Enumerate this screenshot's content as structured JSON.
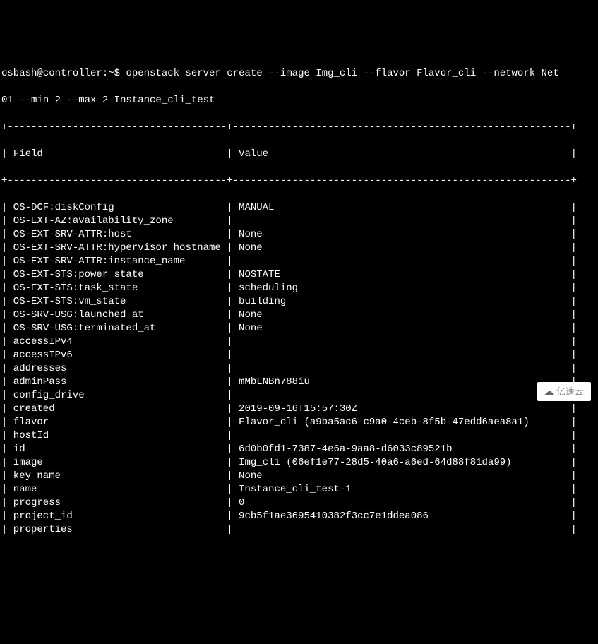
{
  "prompt": {
    "user_host": "osbash@controller:~$",
    "command": "openstack server create --image Img_cli --flavor Flavor_cli --network Net",
    "command_line2": "01 --min 2 --max 2 Instance_cli_test"
  },
  "table": {
    "border_top": "+-----------------------------------+---------------------------------------------+",
    "header_field": "Field",
    "header_value": "Value",
    "rows": [
      {
        "field": "OS-DCF:diskConfig",
        "value": "MANUAL"
      },
      {
        "field": "OS-EXT-AZ:availability_zone",
        "value": ""
      },
      {
        "field": "OS-EXT-SRV-ATTR:host",
        "value": "None"
      },
      {
        "field": "OS-EXT-SRV-ATTR:hypervisor_hostname",
        "value": "None"
      },
      {
        "field": "OS-EXT-SRV-ATTR:instance_name",
        "value": ""
      },
      {
        "field": "OS-EXT-STS:power_state",
        "value": "NOSTATE"
      },
      {
        "field": "OS-EXT-STS:task_state",
        "value": "scheduling"
      },
      {
        "field": "OS-EXT-STS:vm_state",
        "value": "building"
      },
      {
        "field": "OS-SRV-USG:launched_at",
        "value": "None"
      },
      {
        "field": "OS-SRV-USG:terminated_at",
        "value": "None"
      },
      {
        "field": "accessIPv4",
        "value": ""
      },
      {
        "field": "accessIPv6",
        "value": ""
      },
      {
        "field": "addresses",
        "value": ""
      },
      {
        "field": "adminPass",
        "value": "mMbLNBn788iu"
      },
      {
        "field": "config_drive",
        "value": ""
      },
      {
        "field": "created",
        "value": "2019-09-16T15:57:30Z"
      },
      {
        "field": "flavor",
        "value": "Flavor_cli (a9ba5ac6-c9a0-4ceb-8f5b-47edd6aea8a1)"
      },
      {
        "field": "hostId",
        "value": ""
      },
      {
        "field": "id",
        "value": "6d0b0fd1-7387-4e6a-9aa8-d6033c89521b"
      },
      {
        "field": "image",
        "value": "Img_cli (06ef1e77-28d5-40a6-a6ed-64d88f81da99)"
      },
      {
        "field": "key_name",
        "value": "None"
      },
      {
        "field": "name",
        "value": "Instance_cli_test-1"
      },
      {
        "field": "progress",
        "value": "0"
      },
      {
        "field": "project_id",
        "value": "9cb5f1ae3695410382f3cc7e1ddea086"
      },
      {
        "field": "properties",
        "value": ""
      }
    ]
  },
  "watermark": {
    "text": "亿速云"
  }
}
